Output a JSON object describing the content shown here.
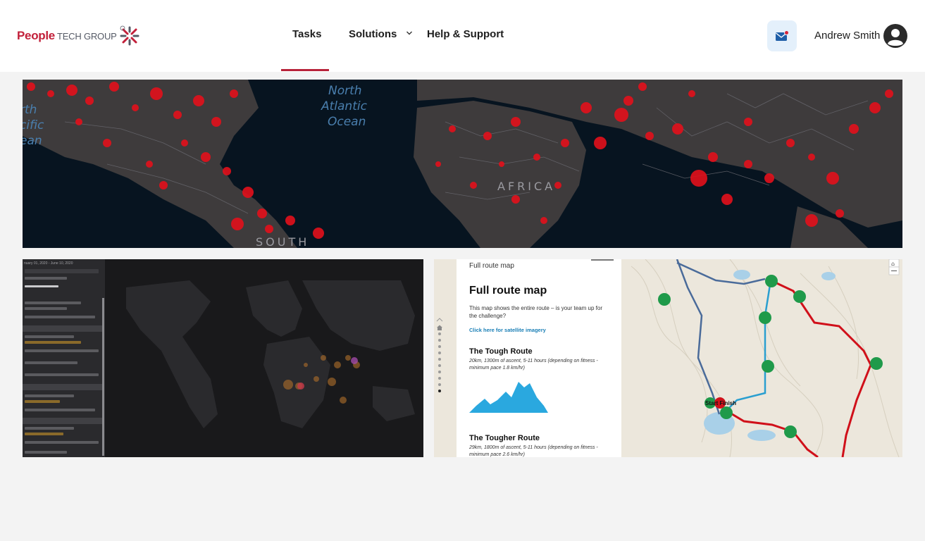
{
  "brand": {
    "name_primary": "People",
    "name_secondary": "TECH GROUP",
    "registered_mark": "®",
    "accent_color": "#c2203a"
  },
  "nav": {
    "items": [
      {
        "label": "Tasks",
        "active": true
      },
      {
        "label": "Solutions",
        "has_dropdown": true
      },
      {
        "label": "Help & Support"
      }
    ]
  },
  "header_actions": {
    "mail_icon": "mail-notification-icon",
    "user_name": "Andrew Smith",
    "avatar_icon": "user-circle-icon"
  },
  "banner": {
    "labels": {
      "ocean_north_atlantic": [
        "North",
        "Atlantic",
        "Ocean"
      ],
      "ocean_pacific_partial": [
        "rth",
        "cific",
        "ean"
      ],
      "continent_africa": "AFRICA",
      "continent_south": "SOUTH"
    }
  },
  "tile_left": {
    "side_panel_header": "nuary 01, 2020 - June 10, 2020"
  },
  "tile_right": {
    "panel_small_title": "Full route map",
    "panel_title": "Full route map",
    "panel_description": "This map shows the entire route – is your team up for the challenge?",
    "satellite_link": "Click here for satellite imagery",
    "routes": [
      {
        "name": "The Tough Route",
        "details": "20km, 1300m of ascent, 5-11 hours (depending on fitness - minimum pace 1.8 km/hr)"
      },
      {
        "name": "The Tougher Route",
        "details": "29km, 1800m of ascent, 5-11 hours (depending on fitness - minimum pace 2.6 km/hr)"
      }
    ],
    "map_label": "Start Finish"
  }
}
